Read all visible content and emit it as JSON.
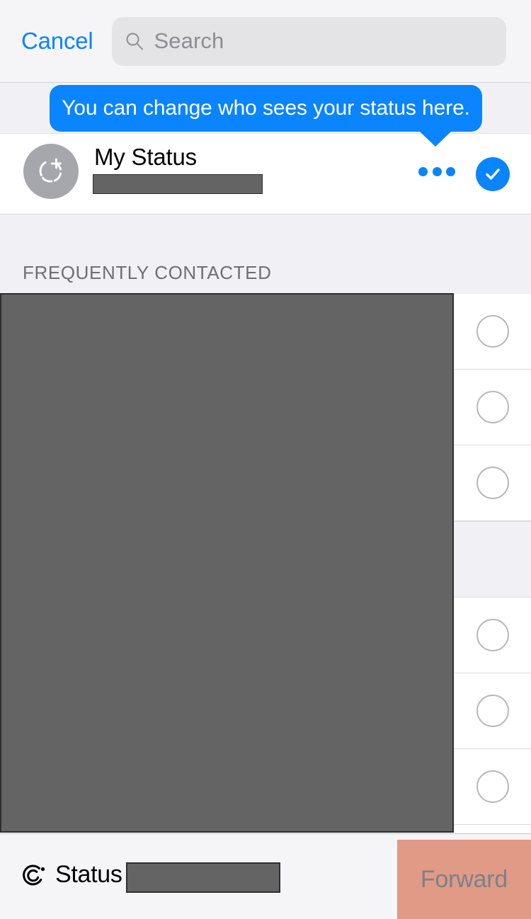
{
  "header": {
    "cancel_label": "Cancel",
    "search_placeholder": "Search",
    "search_value": "",
    "search_icon": "search-icon"
  },
  "tooltip": {
    "text": "You can change who sees your status here.",
    "color": "#0a84ff"
  },
  "my_status": {
    "title": "My Status",
    "avatar_icon": "add-status-avatar-icon",
    "subtitle_redacted": true,
    "more_icon": "more-horizontal-icon",
    "confirm_icon": "check-circle-icon",
    "accent_color": "#0a84ff"
  },
  "section": {
    "header_label": "FREQUENTLY CONTACTED"
  },
  "list": {
    "redacted": true,
    "rows": [
      {
        "type": "contact",
        "name_redacted": true,
        "selected": false,
        "select_icon": "empty-circle-icon"
      },
      {
        "type": "contact",
        "name_redacted": true,
        "selected": false,
        "select_icon": "empty-circle-icon"
      },
      {
        "type": "contact",
        "name_redacted": true,
        "selected": false,
        "select_icon": "empty-circle-icon"
      },
      {
        "type": "section-band",
        "name_redacted": true,
        "selected": false,
        "select_icon": ""
      },
      {
        "type": "contact",
        "name_redacted": true,
        "selected": false,
        "select_icon": "empty-circle-icon"
      },
      {
        "type": "contact",
        "name_redacted": true,
        "selected": false,
        "select_icon": "empty-circle-icon"
      },
      {
        "type": "contact",
        "name_redacted": true,
        "selected": false,
        "select_icon": "empty-circle-icon"
      }
    ]
  },
  "bottom_bar": {
    "status_tab_label": "Status",
    "status_tab_icon": "status-rings-icon",
    "value_redacted": true,
    "forward_label": "Forward",
    "forward_highlight_color": "#e09a86"
  }
}
